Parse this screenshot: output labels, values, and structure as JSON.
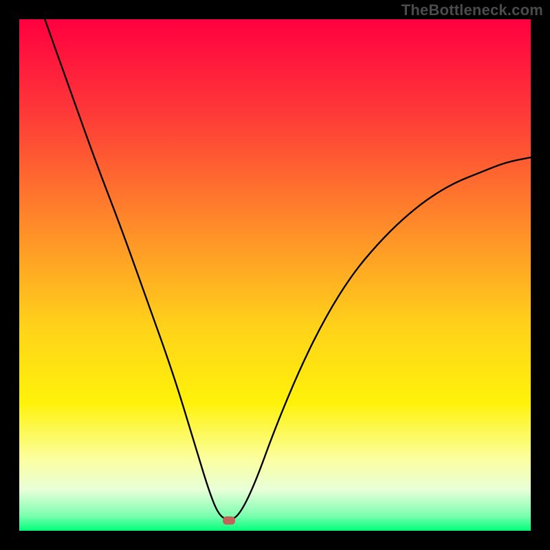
{
  "watermark": "TheBottleneck.com",
  "chart_data": {
    "type": "line",
    "title": "",
    "xlabel": "",
    "ylabel": "",
    "xlim": [
      0,
      100
    ],
    "ylim": [
      0,
      100
    ],
    "grid": false,
    "legend": false,
    "background_gradient": {
      "stops": [
        {
          "offset": 0,
          "color": "#ff0040"
        },
        {
          "offset": 18,
          "color": "#fe3838"
        },
        {
          "offset": 40,
          "color": "#ff8a2a"
        },
        {
          "offset": 60,
          "color": "#ffd21a"
        },
        {
          "offset": 75,
          "color": "#fff20a"
        },
        {
          "offset": 86,
          "color": "#fbffa0"
        },
        {
          "offset": 92,
          "color": "#e8ffd8"
        },
        {
          "offset": 97,
          "color": "#7dffb0"
        },
        {
          "offset": 100,
          "color": "#00ff7a"
        }
      ]
    },
    "marker": {
      "x": 41,
      "y": 2,
      "color": "#c0645a",
      "shape": "rounded-rect"
    },
    "series": [
      {
        "name": "curve",
        "color": "#000000",
        "points": [
          {
            "x": 5,
            "y": 100
          },
          {
            "x": 10,
            "y": 86
          },
          {
            "x": 15,
            "y": 72
          },
          {
            "x": 20,
            "y": 59
          },
          {
            "x": 25,
            "y": 45
          },
          {
            "x": 30,
            "y": 31
          },
          {
            "x": 34,
            "y": 18
          },
          {
            "x": 37,
            "y": 8
          },
          {
            "x": 39,
            "y": 3
          },
          {
            "x": 41,
            "y": 2
          },
          {
            "x": 43,
            "y": 3
          },
          {
            "x": 46,
            "y": 9
          },
          {
            "x": 50,
            "y": 20
          },
          {
            "x": 55,
            "y": 32
          },
          {
            "x": 60,
            "y": 42
          },
          {
            "x": 65,
            "y": 50
          },
          {
            "x": 70,
            "y": 56
          },
          {
            "x": 75,
            "y": 61
          },
          {
            "x": 80,
            "y": 65
          },
          {
            "x": 85,
            "y": 68
          },
          {
            "x": 90,
            "y": 70
          },
          {
            "x": 95,
            "y": 72
          },
          {
            "x": 100,
            "y": 73
          }
        ]
      }
    ]
  }
}
